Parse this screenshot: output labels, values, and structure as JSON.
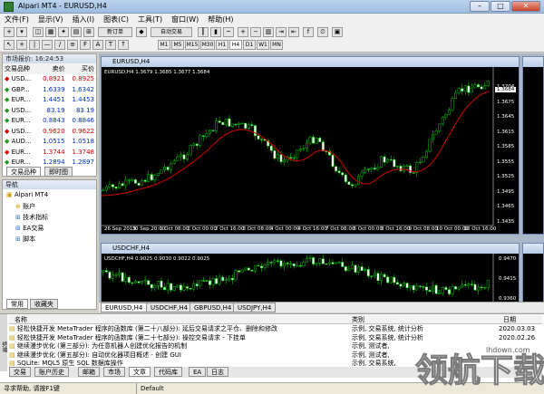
{
  "window": {
    "title": "Alpari MT4 - EURUSD,H4"
  },
  "menu": [
    "文件(F)",
    "显示(V)",
    "插入(I)",
    "图表(C)",
    "工具(T)",
    "窗口(W)",
    "帮助(H)"
  ],
  "toolbar": {
    "new_order": "新订单",
    "autotrading": "自动交易",
    "timeframes": [
      "M1",
      "M5",
      "M15",
      "M30",
      "H1",
      "H4",
      "D1",
      "W1",
      "MN"
    ]
  },
  "market_watch": {
    "title": "市场报价: 16:24:53",
    "headers": [
      "交易品种",
      "卖价",
      "买价"
    ],
    "rows": [
      {
        "symbol": "USD...",
        "bid": "0.8921",
        "ask": "0.8925",
        "dir": "down"
      },
      {
        "symbol": "GBP...",
        "bid": "1.6339",
        "ask": "1.6342",
        "dir": "up"
      },
      {
        "symbol": "EUR...",
        "bid": "1.4451",
        "ask": "1.4453",
        "dir": "up"
      },
      {
        "symbol": "USD...",
        "bid": "83.19",
        "ask": "83.19",
        "dir": "up"
      },
      {
        "symbol": "EUR...",
        "bid": "0.8843",
        "ask": "0.8846",
        "dir": "up"
      },
      {
        "symbol": "USD...",
        "bid": "0.9620",
        "ask": "0.9622",
        "dir": "down"
      },
      {
        "symbol": "AUD...",
        "bid": "1.0515",
        "ask": "1.0518",
        "dir": "up"
      },
      {
        "symbol": "EUR...",
        "bid": "1.3744",
        "ask": "1.3748",
        "dir": "down"
      },
      {
        "symbol": "EUR...",
        "bid": "1.2894",
        "ask": "1.2897",
        "dir": "up"
      }
    ],
    "tabs": [
      "交易品种",
      "即时图"
    ]
  },
  "navigator": {
    "title": "导航",
    "items": [
      "Alpari MT4",
      "账户",
      "技术指标",
      "EA交易",
      "脚本"
    ],
    "tabs": [
      "常用",
      "收藏夹"
    ]
  },
  "charts": [
    {
      "title": "EURUSD,H4",
      "info": "EURUSD,H4  1.3679 1.3685 1.3677 1.3684",
      "price_labels": [
        "1.3704",
        "1.3675",
        "1.3645",
        "1.3615",
        "1.3585",
        "1.3555",
        "1.3525",
        "1.3495",
        "1.3465",
        "1.3435"
      ],
      "time_labels": [
        "26 Sep 2013",
        "30 Sep 20:00",
        "1 Oct 08:00",
        "2 Oct 00:00",
        "2 Oct 16:00",
        "3 Oct 08:00",
        "4 Oct 00:00",
        "4 Oct 16:00",
        "7 Oct 08:00",
        "8 Oct 00:00",
        "8 Oct 16:00",
        "9 Oct 08:00",
        "10 Oct 00:00",
        "10 Oct 16:00"
      ],
      "current_price": "1.3684"
    },
    {
      "title": "USDCHF,H4",
      "info": "USDCHF,H4  0.9025 0.9030 0.9022 0.9025",
      "price_labels": [
        "0.9470",
        "0.9415",
        "0.9360"
      ]
    },
    {
      "title": "",
      "info": "",
      "price_labels": []
    }
  ],
  "chart_tabs": [
    "EURUSD,H4",
    "USDCHF,H4",
    "GBPUSD,H4",
    "USDJPY,H4"
  ],
  "terminal": {
    "headers": [
      "名称",
      "类别",
      "日期"
    ],
    "rows": [
      {
        "name": "轻松快捷开发 MetaTrader 程序的函数库 (第二十八部分): 延后交易请求之平仓、删除和修改",
        "cat": "示例, 交易系统, 统计分析",
        "date": "2020.03.03"
      },
      {
        "name": "轻松快捷开发 MetaTrader 程序的函数库 (第二十七部分): 操控交易请求 - 下挂单",
        "cat": "示例, 交易系统, 统计分析",
        "date": "2020.02.26"
      },
      {
        "name": "继续漫步优化 (第三部分): 为任意机器人创建优化报告的机制",
        "cat": "示例, 测试者,",
        "date": ""
      },
      {
        "name": "继续漫步优化 (第五部分): 自动优化器项目概述 - 创建 GUI",
        "cat": "示例, 测试者,",
        "date": ""
      },
      {
        "name": "SQLite: MQL5 原生 SQL 数据库操作",
        "cat": "示例, 交易系统,",
        "date": ""
      }
    ],
    "tabs": [
      "交易",
      "账户历史",
      "邮箱",
      "市场",
      "文章",
      "代码库",
      "EA",
      "日志"
    ],
    "side_label": "终端"
  },
  "status": {
    "help": "寻求帮助, 请按F1键",
    "profile": "Default"
  },
  "watermark": "领航下载",
  "watermark_url": "lhdown.com"
}
